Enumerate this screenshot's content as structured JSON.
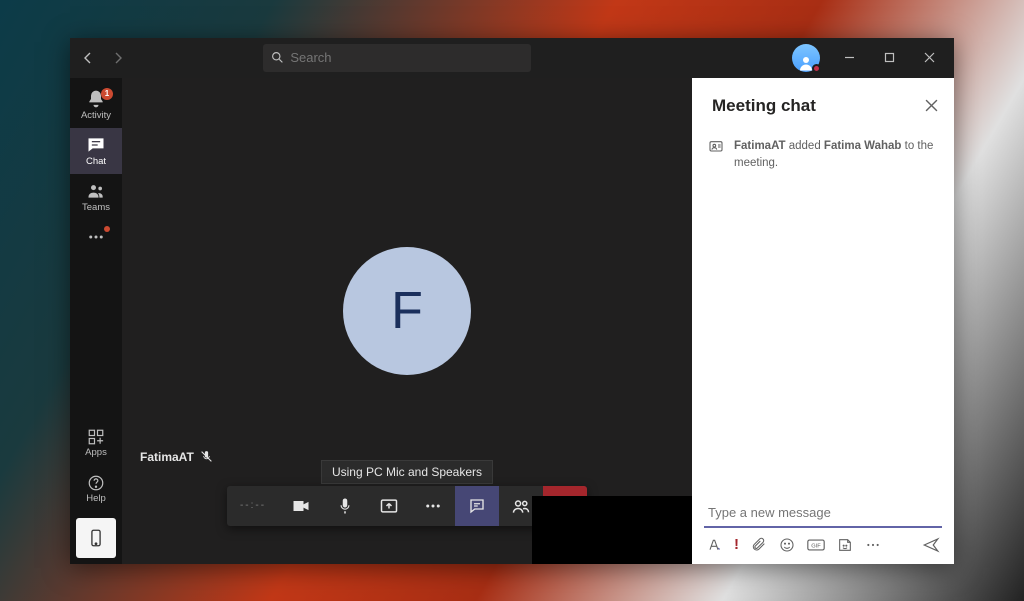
{
  "titlebar": {
    "search_placeholder": "Search"
  },
  "rail": {
    "activity": {
      "label": "Activity",
      "badge": "1"
    },
    "chat": {
      "label": "Chat"
    },
    "teams": {
      "label": "Teams"
    },
    "apps": {
      "label": "Apps"
    },
    "help": {
      "label": "Help"
    }
  },
  "call": {
    "participant_initial": "F",
    "participant_name": "FatimaAT",
    "tooltip": "Using PC Mic and Speakers",
    "timer": "--:--"
  },
  "chat": {
    "title": "Meeting chat",
    "system_msg": {
      "actor": "FatimaAT",
      "verb": " added ",
      "target": "Fatima Wahab",
      "suffix": " to the meeting."
    },
    "compose_placeholder": "Type a new message"
  }
}
